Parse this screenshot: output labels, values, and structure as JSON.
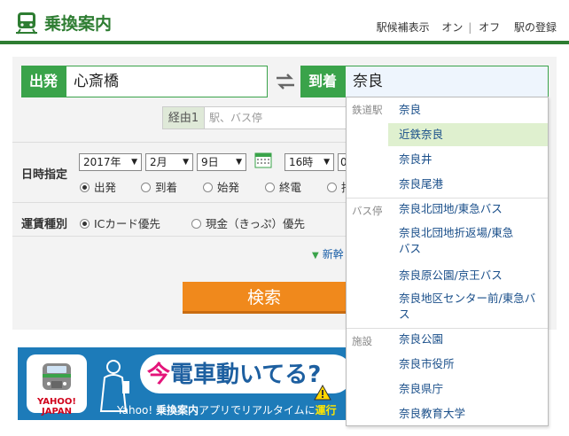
{
  "header": {
    "title": "乗換案内",
    "links": [
      "駅候補表示",
      "オン",
      "オフ",
      "駅の登録"
    ]
  },
  "form": {
    "from_label": "出発",
    "from_value": "心斎橋",
    "to_label": "到着",
    "to_value": "奈良",
    "via_label": "経由1",
    "via_placeholder": "駅、バス停",
    "datetime_label": "日時指定",
    "year": "2017年",
    "month": "2月",
    "day": "9日",
    "hour": "16時",
    "minute": "0",
    "time_types": [
      "出発",
      "到着",
      "始発",
      "終電",
      "指"
    ],
    "time_type_selected": 0,
    "fare_label": "運賃種別",
    "fare_types": [
      "ICカード優先",
      "現金（きっぷ）優先"
    ],
    "fare_selected": 0,
    "more_link": "新幹",
    "search_button": "検索"
  },
  "banner": {
    "brand": "YAHOO! JAPAN",
    "headline_1": "今",
    "headline_2": "電車動いてる?",
    "footer_1": "Yahoo! ",
    "footer_bold": "乗換案内",
    "footer_2": "アプリでリアルタイムに",
    "footer_hl": "運行"
  },
  "suggestions": {
    "groups": [
      {
        "label": "鉄道駅",
        "items": [
          "奈良",
          "近鉄奈良",
          "奈良井",
          "奈良尾港"
        ],
        "highlighted": 1
      },
      {
        "label": "バス停",
        "items": [
          "奈良北団地/東急バス",
          "奈良北団地折返場/東急バス",
          "奈良原公園/京王バス",
          "奈良地区センター前/東急バス"
        ]
      },
      {
        "label": "施設",
        "items": [
          "奈良公園",
          "奈良市役所",
          "奈良県庁",
          "奈良教育大学"
        ]
      }
    ]
  },
  "colors": {
    "brand_green": "#2e7d32",
    "tag_green": "#3aa34a",
    "search_orange": "#f0891c",
    "link_blue": "#1a4f8a",
    "highlight": "#dff0cf"
  }
}
